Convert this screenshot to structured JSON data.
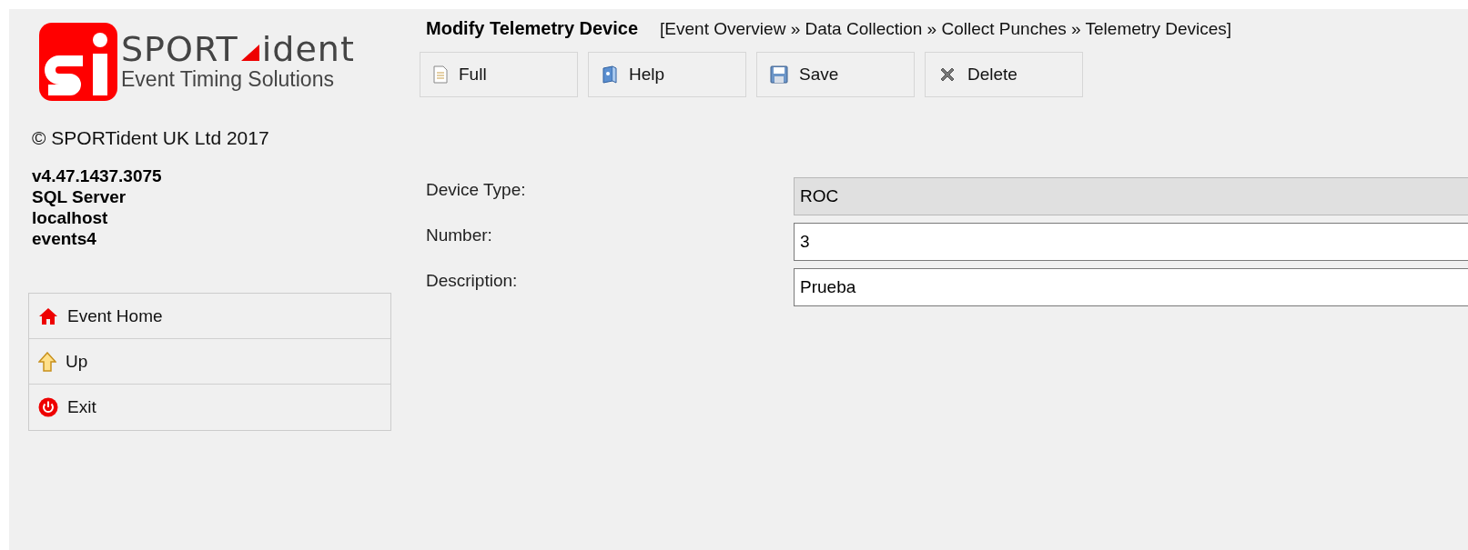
{
  "logo": {
    "brand_left": "SPORT",
    "brand_right": "ident",
    "tagline": "Event Timing Solutions"
  },
  "copyright": "© SPORTident UK Ltd 2017",
  "info_lines": [
    "v4.47.1437.3075",
    "SQL Server",
    "localhost",
    "events4"
  ],
  "nav": [
    {
      "label": "Event Home",
      "kind": "home"
    },
    {
      "label": "Up",
      "kind": "up"
    },
    {
      "label": "Exit",
      "kind": "exit"
    }
  ],
  "header": {
    "title": "Modify Telemetry Device",
    "breadcrumb": "[Event Overview » Data Collection » Collect Punches » Telemetry Devices]"
  },
  "toolbar": [
    {
      "label": "Full",
      "kind": "document"
    },
    {
      "label": "Help",
      "kind": "help"
    },
    {
      "label": "Save",
      "kind": "save"
    },
    {
      "label": "Delete",
      "kind": "delete"
    }
  ],
  "fields": [
    {
      "label": "Device Type:",
      "value": "ROC",
      "disabled": true
    },
    {
      "label": "Number:",
      "value": "3",
      "disabled": false
    },
    {
      "label": "Description:",
      "value": "Prueba",
      "disabled": false
    }
  ]
}
